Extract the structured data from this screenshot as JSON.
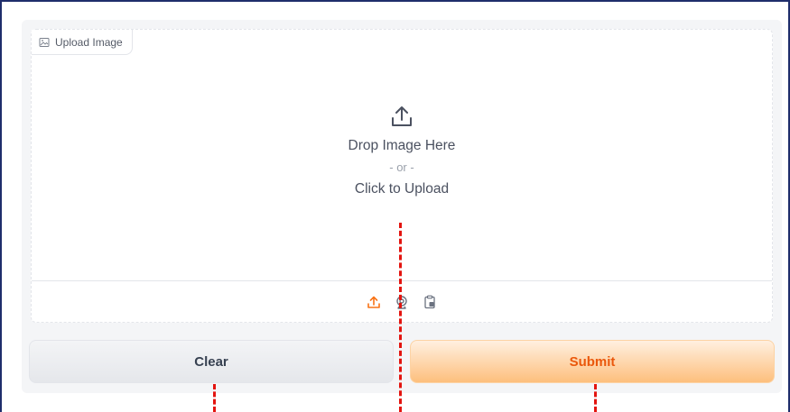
{
  "upload": {
    "label": "Upload Image",
    "drop_text": "Drop Image Here",
    "or_text": "- or -",
    "click_text": "Click to Upload"
  },
  "sources": [
    {
      "name": "upload-source",
      "icon": "upload-icon"
    },
    {
      "name": "webcam-source",
      "icon": "webcam-icon"
    },
    {
      "name": "clipboard-source",
      "icon": "clipboard-icon"
    }
  ],
  "buttons": {
    "clear_label": "Clear",
    "submit_label": "Submit"
  },
  "colors": {
    "accent": "#f97316",
    "frame_border": "#1f2d6b",
    "annotation_dash": "#e3140f",
    "submit_text": "#ea580c"
  }
}
